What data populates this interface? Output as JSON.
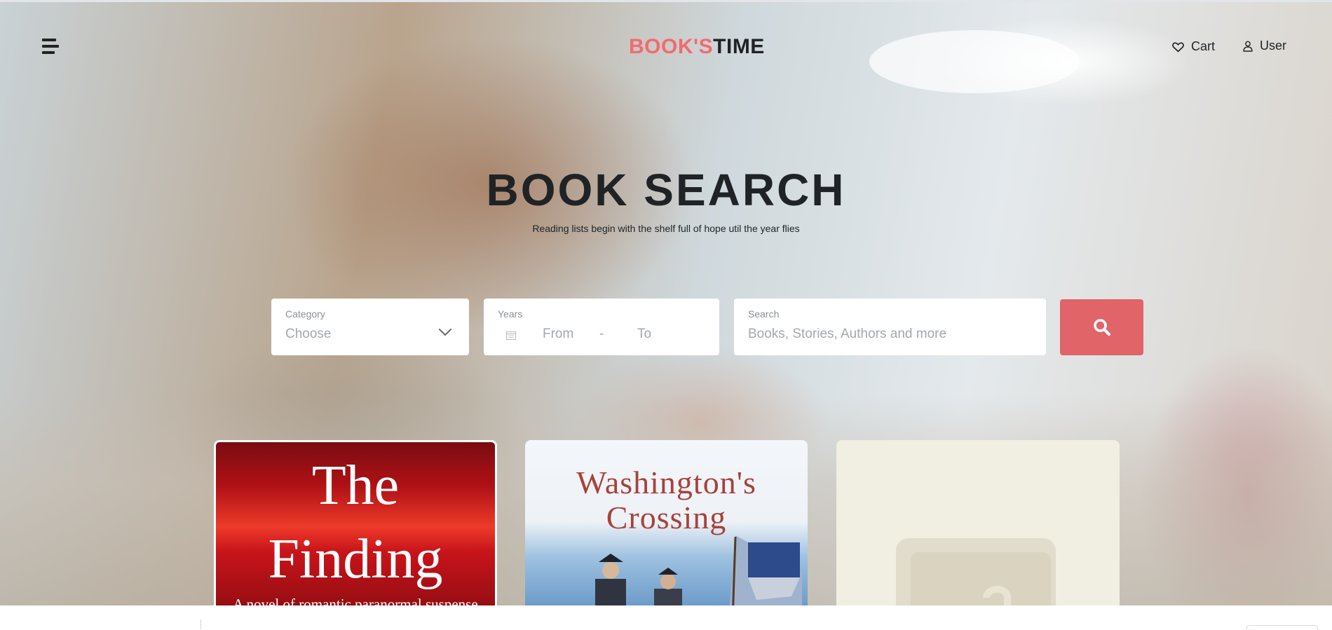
{
  "header": {
    "logo_part1": "BOOK'S",
    "logo_part2": "TIME",
    "menu_icon": "hamburger-menu-icon",
    "cart_label": "Cart",
    "cart_icon": "heart-icon",
    "user_label": "User",
    "user_icon": "user-icon"
  },
  "hero": {
    "title": "BOOK SEARCH",
    "subtitle": "Reading lists begin with the shelf full of hope util the year flies"
  },
  "search_form": {
    "category": {
      "label": "Category",
      "value": "Choose",
      "icon": "chevron-down-icon"
    },
    "years": {
      "label": "Years",
      "icon": "calendar-icon",
      "from": "From",
      "separator": "-",
      "to": "To"
    },
    "search": {
      "label": "Search",
      "placeholder": "Books, Stories, Authors and more"
    },
    "submit_icon": "search-icon"
  },
  "books": [
    {
      "title_line1": "The",
      "title_line2": "Finding",
      "tagline": "A novel of romantic paranormal suspense"
    },
    {
      "title_line1": "Washington's",
      "title_line2": "Crossing"
    },
    {
      "placeholder_icon": "book-placeholder-icon"
    }
  ],
  "colors": {
    "accent": "#e06468",
    "logo_accent": "#f26b6f",
    "text_dark": "#1f2326",
    "placeholder_card": "#f1eee2"
  }
}
